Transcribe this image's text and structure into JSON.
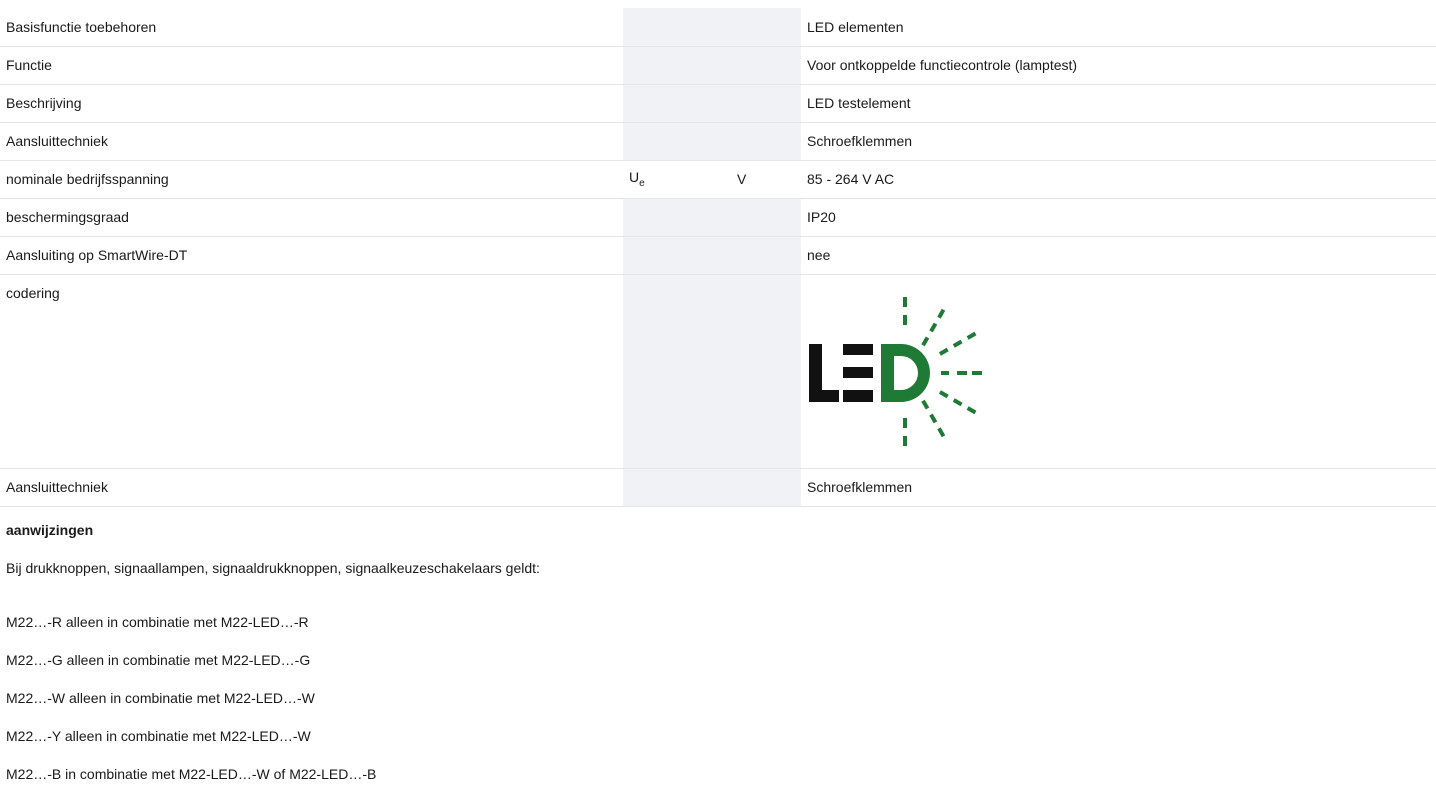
{
  "specs": [
    {
      "label": "Basisfunctie toebehoren",
      "symbol": "",
      "symbol_sub": "",
      "unit": "",
      "value": "LED elementen"
    },
    {
      "label": "Functie",
      "symbol": "",
      "symbol_sub": "",
      "unit": "",
      "value": "Voor ontkoppelde functiecontrole (lamptest)"
    },
    {
      "label": "Beschrijving",
      "symbol": "",
      "symbol_sub": "",
      "unit": "",
      "value": "LED testelement"
    },
    {
      "label": "Aansluittechniek",
      "symbol": "",
      "symbol_sub": "",
      "unit": "",
      "value": "Schroefklemmen"
    },
    {
      "label": "nominale bedrijfsspanning",
      "symbol": "U",
      "symbol_sub": "e",
      "unit": "V",
      "value": "85 - 264 V AC"
    },
    {
      "label": "beschermingsgraad",
      "symbol": "",
      "symbol_sub": "",
      "unit": "",
      "value": "IP20"
    },
    {
      "label": "Aansluiting op SmartWire-DT",
      "symbol": "",
      "symbol_sub": "",
      "unit": "",
      "value": "nee"
    },
    {
      "label": "codering",
      "symbol": "",
      "symbol_sub": "",
      "unit": "",
      "value": ""
    },
    {
      "label": "Aansluittechniek",
      "symbol": "",
      "symbol_sub": "",
      "unit": "",
      "value": "Schroefklemmen"
    }
  ],
  "logo": {
    "text": "LED",
    "icon": "led-logo-icon",
    "colors": {
      "dark": "#111111",
      "green": "#1e7a34"
    }
  },
  "notes": {
    "title": "aanwijzingen",
    "intro": "Bij drukknoppen, signaallampen, signaaldrukknoppen, signaalkeuzeschakelaars geldt:",
    "lines": [
      "M22…-R alleen in combinatie met M22-LED…-R",
      "M22…-G alleen in combinatie met M22-LED…-G",
      "M22…-W alleen in combinatie met M22-LED…-W",
      "M22…-Y alleen in combinatie met M22-LED…-W",
      "M22…-B in combinatie met M22-LED…-W of M22-LED…-B"
    ]
  },
  "colors": {
    "heading": "#1f6fb3",
    "meta_bg": "#f1f2f5",
    "row_border": "#e4e6ea"
  }
}
